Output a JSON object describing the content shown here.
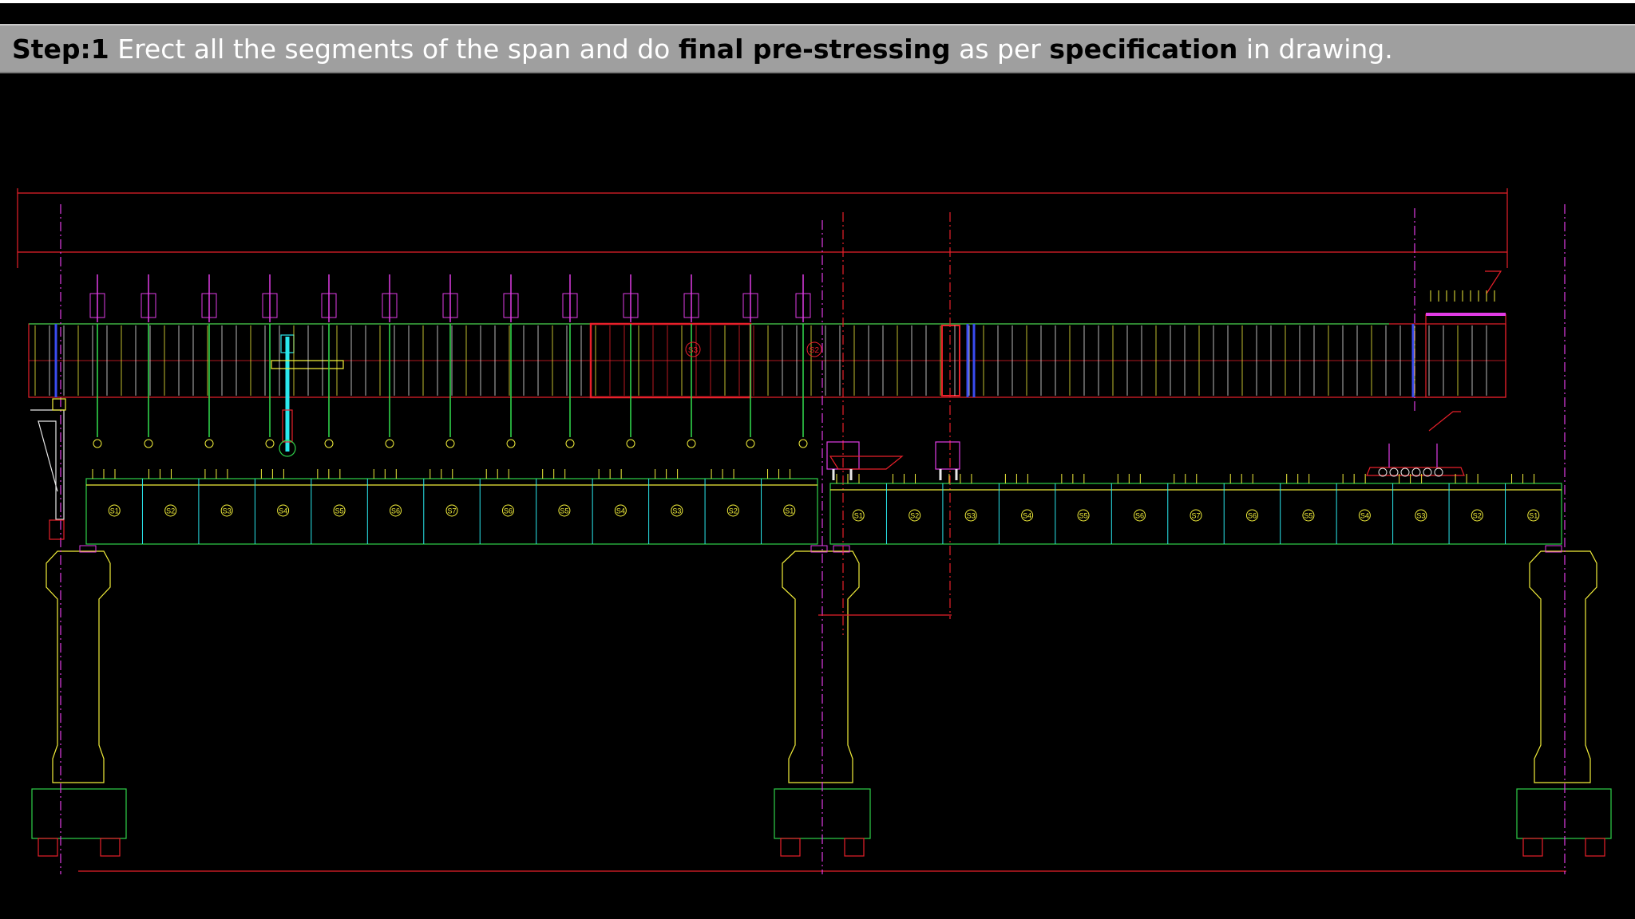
{
  "step_label": "Step:1",
  "instruction": {
    "part1": "Erect all the segments of the span and do",
    "bold1": "final pre-stressing",
    "part2": "as per",
    "bold2": "specification",
    "part3": "in drawing."
  },
  "colors": {
    "banner_bg": "#9f9f9f",
    "cad_red": "#e8202a",
    "cad_green": "#2fd24a",
    "cad_yellow": "#f2ee3a",
    "cad_magenta": "#e13ce6",
    "cad_cyan": "#2ae8ee",
    "cad_blue": "#3a4cf0",
    "cad_white": "#e8e8e8"
  },
  "left_span_segments": [
    "S1",
    "S2",
    "S3",
    "S4",
    "S5",
    "S6",
    "S7",
    "S6",
    "S5",
    "S4",
    "S3",
    "S2",
    "S1"
  ],
  "right_span_segments": [
    "S1",
    "S2",
    "S3",
    "S4",
    "S5",
    "S6",
    "S7",
    "S6",
    "S5",
    "S4",
    "S3",
    "S2",
    "S1"
  ],
  "launcher_labels": [
    "S3",
    "S2"
  ]
}
